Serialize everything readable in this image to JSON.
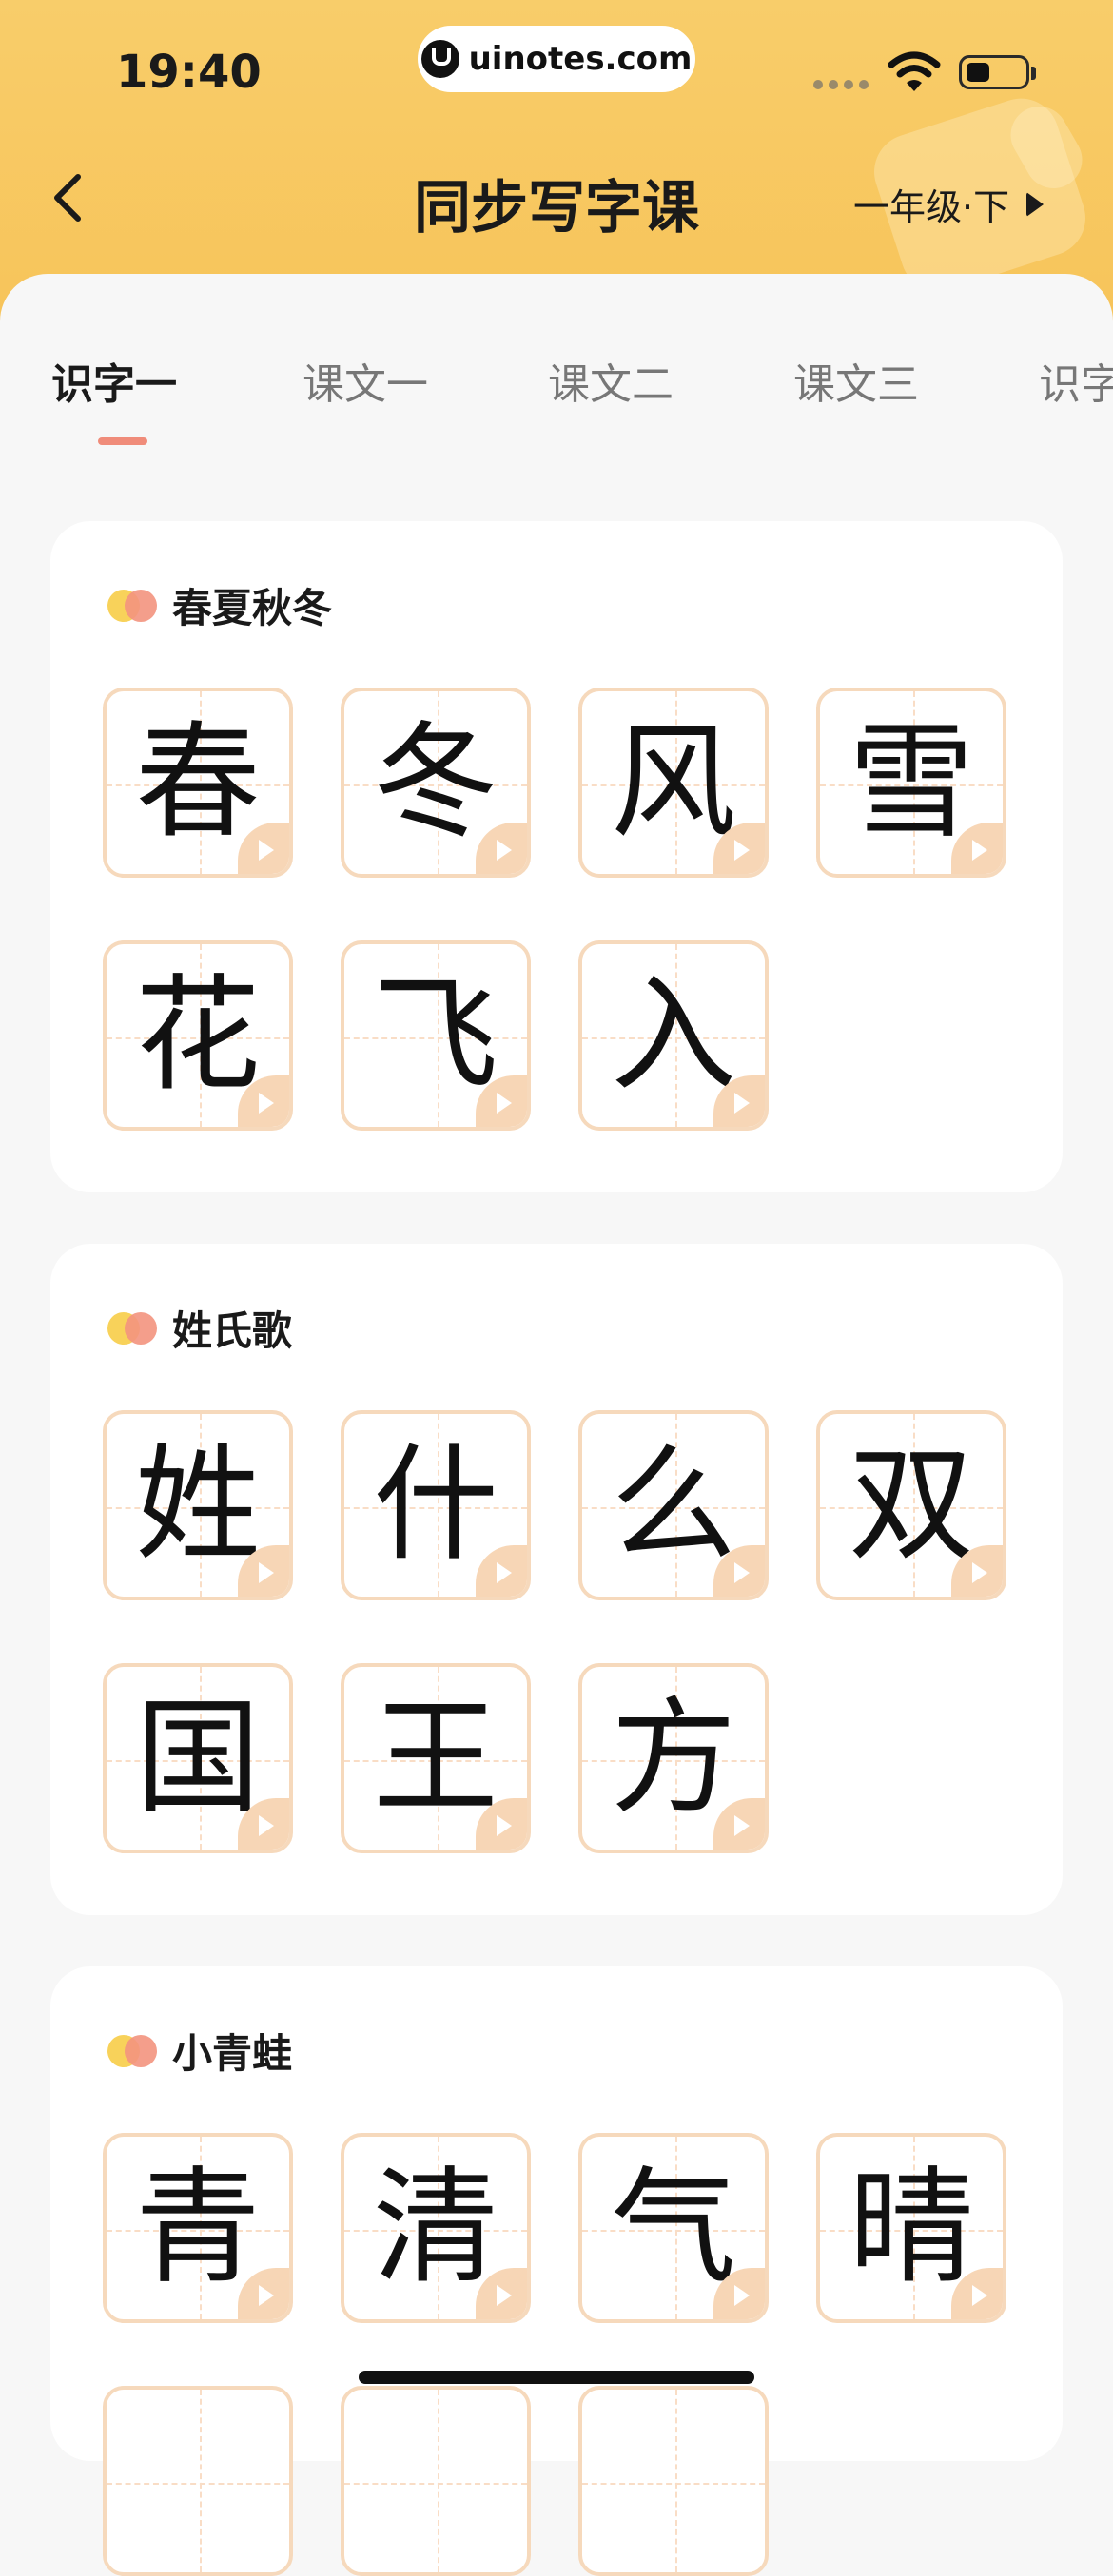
{
  "status_bar": {
    "time": "19:40",
    "url": "uinotes.com"
  },
  "header": {
    "title": "同步写字课",
    "grade": "一年级·下"
  },
  "tabs": [
    {
      "label": "识字一",
      "active": true
    },
    {
      "label": "课文一"
    },
    {
      "label": "课文二"
    },
    {
      "label": "课文三"
    },
    {
      "label": "识字"
    }
  ],
  "lessons": [
    {
      "title": "春夏秋冬",
      "chars": [
        "春",
        "冬",
        "风",
        "雪",
        "花",
        "飞",
        "入"
      ]
    },
    {
      "title": "姓氏歌",
      "chars": [
        "姓",
        "什",
        "么",
        "双",
        "国",
        "王",
        "方"
      ]
    },
    {
      "title": "小青蛙",
      "chars": [
        "青",
        "清",
        "气",
        "晴"
      ]
    }
  ],
  "colors": {
    "accent": "#F7C45A",
    "tab_indicator": "#F08C7A",
    "tile_border": "#F6D9BC"
  }
}
